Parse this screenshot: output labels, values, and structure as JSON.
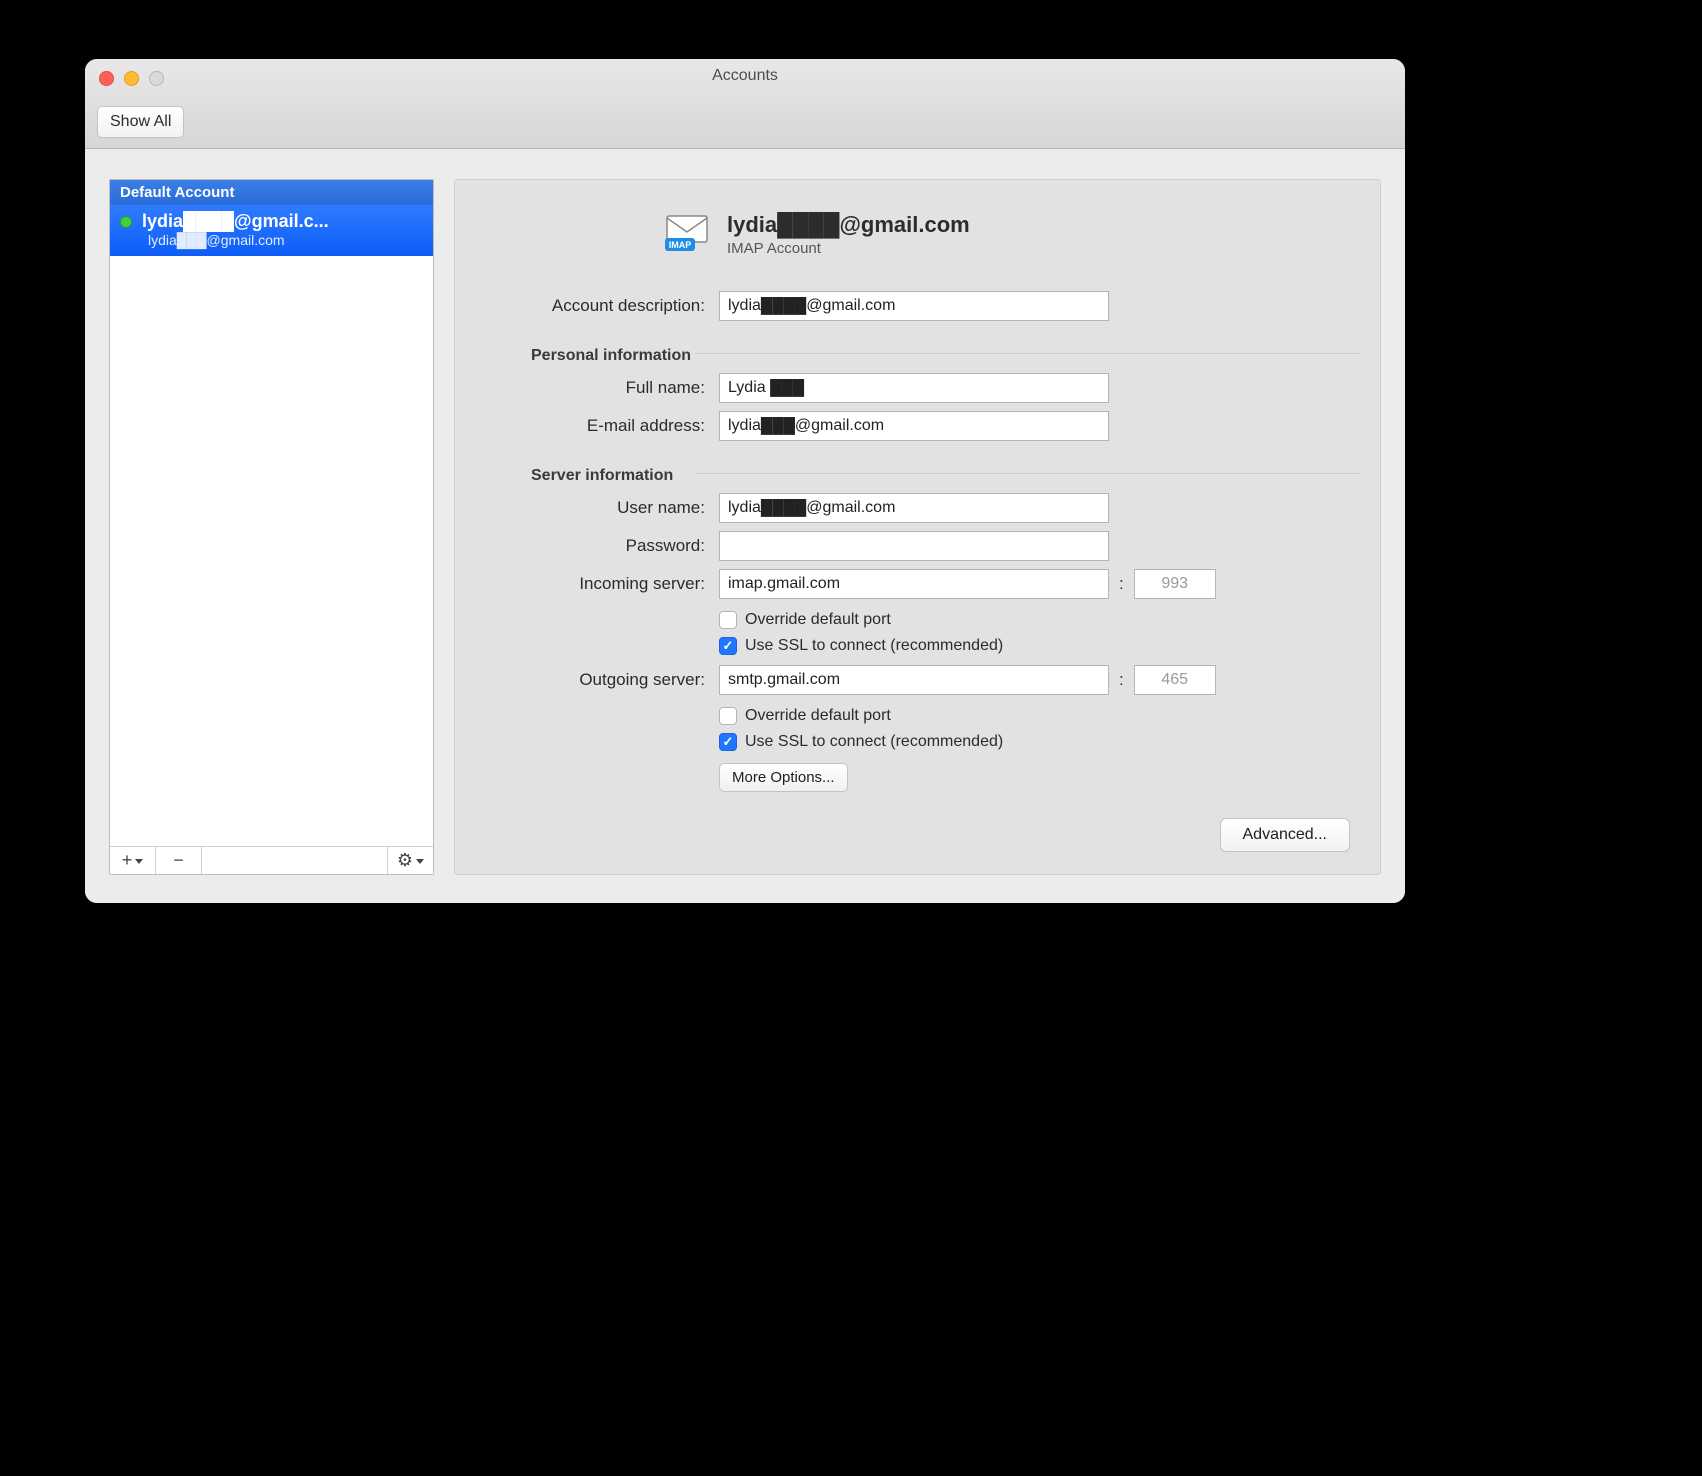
{
  "window": {
    "title": "Accounts"
  },
  "toolbar": {
    "show_all_label": "Show All"
  },
  "sidebar": {
    "section_header": "Default Account",
    "account": {
      "display_name": "lydia████@gmail.c...",
      "subtitle": "lydia███@gmail.com"
    },
    "footer": {
      "add_label": "+",
      "remove_label": "−",
      "gear_label": "⚙"
    }
  },
  "header": {
    "title": "lydia████@gmail.com",
    "subtitle": "IMAP Account",
    "icon_badge": "IMAP"
  },
  "labels": {
    "account_description": "Account description:",
    "personal_info": "Personal information",
    "full_name": "Full name:",
    "email_address": "E-mail address:",
    "server_info": "Server information",
    "user_name": "User name:",
    "password": "Password:",
    "incoming_server": "Incoming server:",
    "outgoing_server": "Outgoing server:",
    "override_port": "Override default port",
    "use_ssl": "Use SSL to connect (recommended)",
    "more_options": "More Options...",
    "advanced": "Advanced..."
  },
  "values": {
    "account_description": "lydia████@gmail.com",
    "full_name": "Lydia ███",
    "email_address": "lydia███@gmail.com",
    "user_name": "lydia████@gmail.com",
    "password": "",
    "incoming_server": "imap.gmail.com",
    "incoming_port": "993",
    "incoming_override": false,
    "incoming_ssl": true,
    "outgoing_server": "smtp.gmail.com",
    "outgoing_port": "465",
    "outgoing_override": false,
    "outgoing_ssl": true
  },
  "colors": {
    "accent": "#2076ff",
    "sidebar_selection": "#1f6dff"
  }
}
